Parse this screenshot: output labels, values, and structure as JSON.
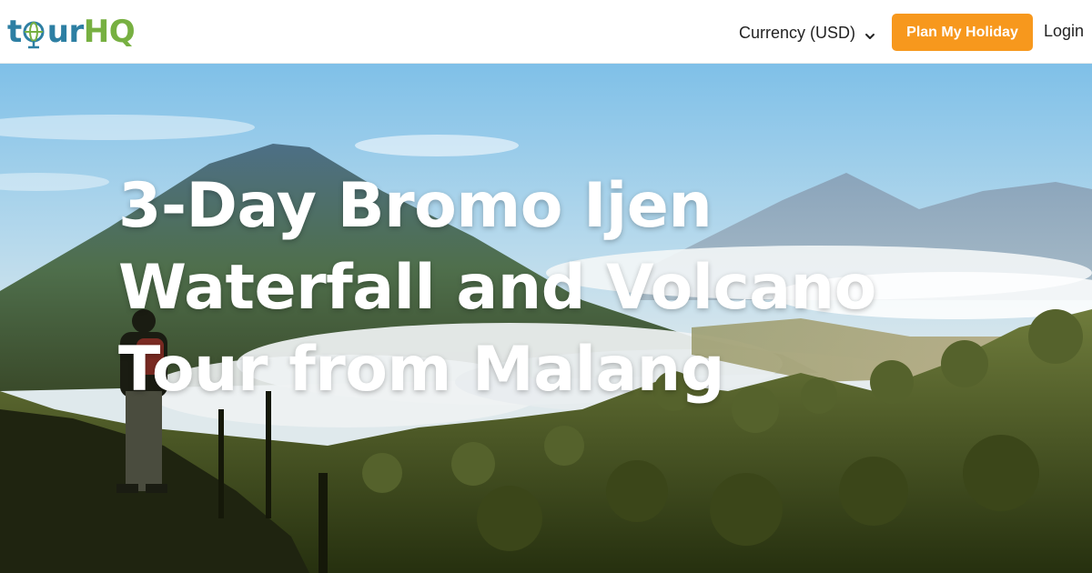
{
  "header": {
    "logo": {
      "part1": "t",
      "part2": "ur",
      "part3": "HQ"
    },
    "currency_label": "Currency (USD)",
    "plan_button": "Plan My Holiday",
    "login": "Login"
  },
  "hero": {
    "title": "3-Day Bromo Ijen Waterfall and Volcano Tour from Malang"
  },
  "colors": {
    "logo_blue": "#2d7fa3",
    "logo_green": "#77b041",
    "cta_orange": "#f7981d"
  },
  "icons": {
    "logo_o": "globe-icon",
    "currency_dropdown": "chevron-down-icon"
  }
}
